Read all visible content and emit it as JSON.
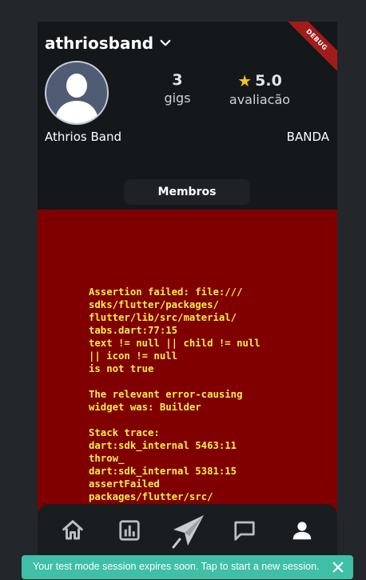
{
  "profile": {
    "username": "athriosband",
    "display_name": "Athrios Band",
    "type": "BANDA",
    "debug_banner": "DEBUG"
  },
  "stats": {
    "gigs_value": "3",
    "gigs_label": "gigs",
    "rating_value": "5.0",
    "rating_label": "avaliacão"
  },
  "tabs": {
    "members_label": "Membros"
  },
  "error": {
    "text": "Assertion failed: file:///\nsdks/flutter/packages/\nflutter/lib/src/material/\ntabs.dart:77:15\ntext != null || child != null\n|| icon != null\nis not true\n\nThe relevant error-causing\nwidget was: Builder\n\nStack trace:\ndart:sdk_internal 5463:11\nthrow_\ndart:sdk_internal 5381:15\nassertFailed\npackages/flutter/src/"
  },
  "nav": {
    "items": [
      "home-icon",
      "chart-icon",
      "rocket-icon",
      "chat-icon",
      "profile-icon"
    ]
  },
  "toast": {
    "message": "Your test mode session expires soon. Tap to start a new session."
  },
  "colors": {
    "error_bg": "#800000",
    "error_text": "#f6ed4a",
    "toast_bg": "#3fbfa6",
    "star": "#f5c518"
  }
}
